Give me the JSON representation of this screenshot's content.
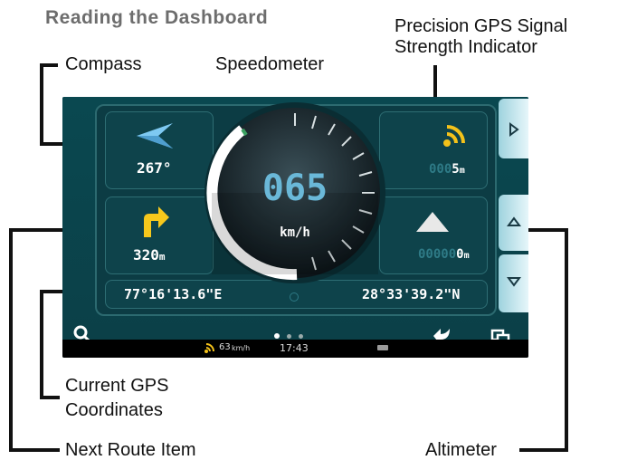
{
  "title": "Reading the Dashboard",
  "callouts": {
    "compass": "Compass",
    "speedometer": "Speedometer",
    "gps_signal_line1": "Precision GPS Signal",
    "gps_signal_line2": "Strength Indicator",
    "gps_coords_line1": "Current GPS",
    "gps_coords_line2": "Coordinates",
    "next_route": "Next Route Item",
    "altimeter": "Altimeter"
  },
  "dashboard": {
    "compass_heading": "267°",
    "next_route_distance_value": "320",
    "next_route_distance_unit": "m",
    "speed": "065",
    "speed_unit": "km/h",
    "signal_dim_digits": "000",
    "signal_value": "5",
    "signal_unit": "m",
    "altitude_dim_digits": "00000",
    "altitude_value": "0",
    "altitude_unit": "m",
    "longitude": "77°16'13.6\"E",
    "latitude": "28°33'39.2\"N"
  },
  "status_bar": {
    "speed": "63",
    "speed_unit": "km/h",
    "time": "17:43"
  },
  "colors": {
    "accent_blue": "#7ec9f2",
    "signal_yellow": "#f4c21a",
    "route_arrow_yellow": "#f6c81c",
    "background_teal": "#0b4048"
  },
  "icons": [
    "compass-arrow-icon",
    "gps-signal-icon",
    "turn-right-icon",
    "mountain-icon",
    "search-icon",
    "back-icon",
    "windows-icon",
    "battery-icon",
    "chevron-right-icon",
    "chevron-up-icon",
    "chevron-down-icon"
  ]
}
